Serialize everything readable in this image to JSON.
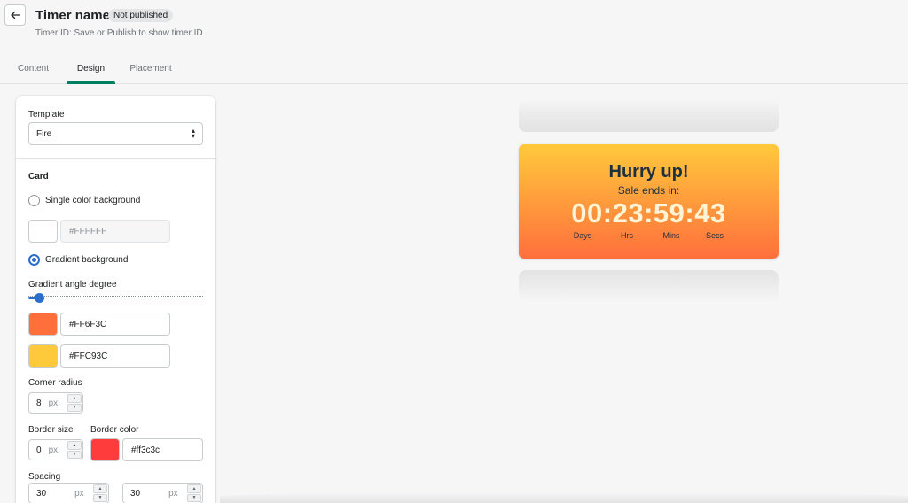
{
  "header": {
    "title": "Timer name",
    "badge": "Not published",
    "subtitle": "Timer ID: Save or Publish to show timer ID"
  },
  "tabs": [
    {
      "label": "Content",
      "active": false
    },
    {
      "label": "Design",
      "active": true
    },
    {
      "label": "Placement",
      "active": false
    }
  ],
  "design": {
    "template_label": "Template",
    "template_value": "Fire",
    "card_title": "Card",
    "single_color_label": "Single color background",
    "single_color_selected": false,
    "single_color_value": "#FFFFFF",
    "gradient_label": "Gradient background",
    "gradient_selected": true,
    "gradient_angle_label": "Gradient angle degree",
    "gradient_angle_value": 0,
    "gradient_angle_fraction": 0.06,
    "gradient_color_1": "#FF6F3C",
    "gradient_color_2": "#FFC93C",
    "corner_radius_label": "Corner radius",
    "corner_radius_value": "8",
    "border_size_label": "Border size",
    "border_size_value": "0",
    "border_color_label": "Border color",
    "border_color_value": "#ff3c3c",
    "spacing_label": "Spacing",
    "spacing_value_1": "30",
    "spacing_value_2": "30",
    "unit": "px"
  },
  "preview": {
    "heading": "Hurry up!",
    "subheading": "Sale ends in:",
    "countdown": "00:23:59:43",
    "units": [
      "Days",
      "Hrs",
      "Mins",
      "Secs"
    ]
  },
  "colors": {
    "accent": "#008060",
    "interactive": "#2c6ecb",
    "text_dark": "#1e2f3e",
    "digits": "#fff5d6"
  }
}
